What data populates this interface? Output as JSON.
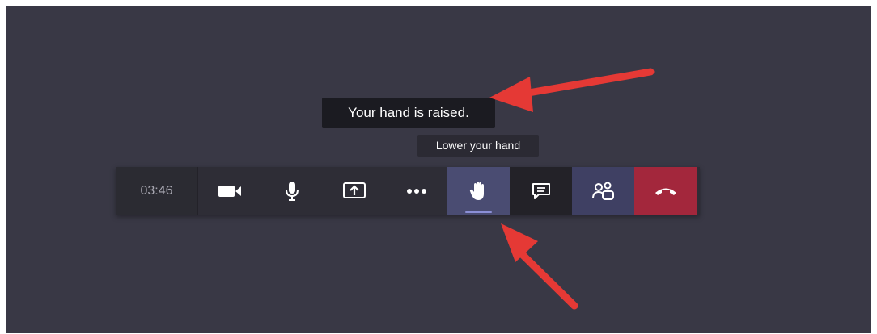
{
  "notification": {
    "text": "Your hand is raised."
  },
  "tooltip": {
    "text": "Lower your hand"
  },
  "toolbar": {
    "timer": "03:46",
    "buttons": [
      {
        "id": "camera",
        "icon": "camera-icon"
      },
      {
        "id": "microphone",
        "icon": "microphone-icon"
      },
      {
        "id": "share",
        "icon": "share-screen-icon"
      },
      {
        "id": "more",
        "icon": "more-options-icon"
      },
      {
        "id": "raise-hand",
        "icon": "hand-icon",
        "active": true
      },
      {
        "id": "chat",
        "icon": "chat-icon"
      },
      {
        "id": "participants",
        "icon": "people-icon"
      },
      {
        "id": "hang-up",
        "icon": "hang-up-icon"
      }
    ]
  },
  "colors": {
    "background": "#393845",
    "toolbar": "#2e2d36",
    "active": "#4a4c72",
    "hangup": "#a3273c",
    "annotation_arrow": "#e53935"
  }
}
